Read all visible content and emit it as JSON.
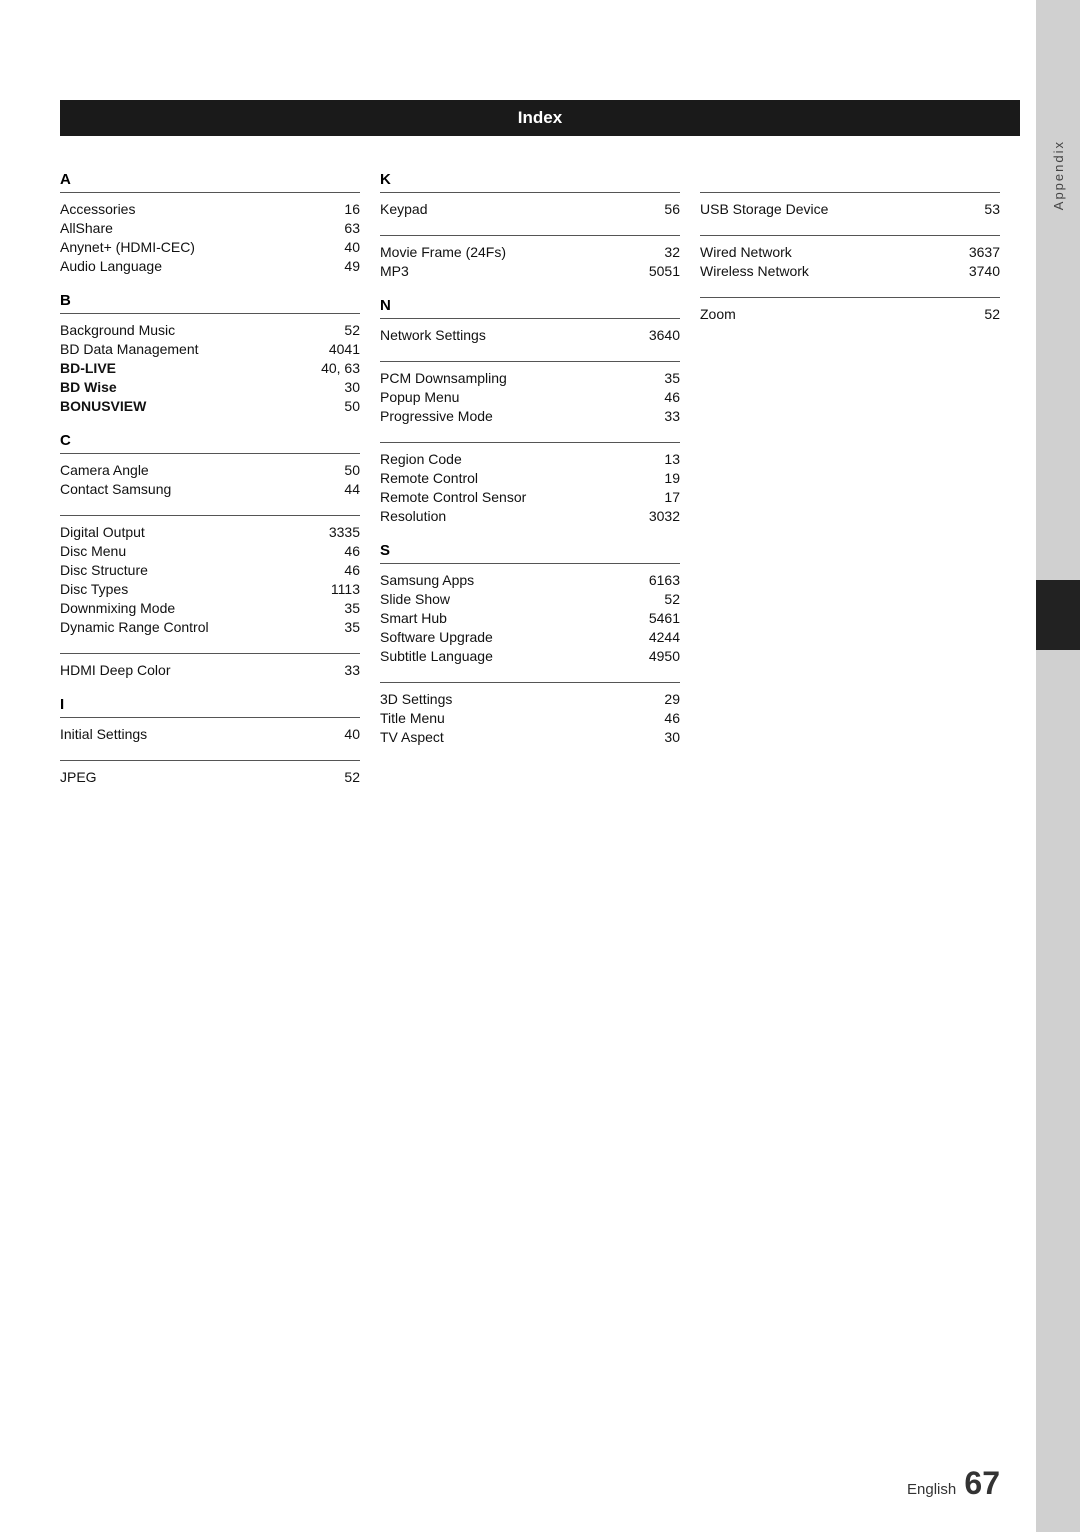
{
  "header": {
    "title": "Index"
  },
  "sidebar": {
    "label": "Appendix"
  },
  "footer": {
    "language": "English",
    "page_number": "67"
  },
  "sections": {
    "A": {
      "letter": "A",
      "entries": [
        {
          "name": "Accessories",
          "page": "16",
          "bold": false
        },
        {
          "name": "AllShare",
          "page": "63",
          "bold": false
        },
        {
          "name": "Anynet+ (HDMI-CEC)",
          "page": "40",
          "bold": false
        },
        {
          "name": "Audio Language",
          "page": "49",
          "bold": false
        }
      ]
    },
    "B": {
      "letter": "B",
      "entries": [
        {
          "name": "Background Music",
          "page": "52",
          "bold": false
        },
        {
          "name": "BD Data Management",
          "page": "4041",
          "bold": false
        },
        {
          "name": "BD-LIVE",
          "page": "40, 63",
          "bold": true
        },
        {
          "name": "BD Wise",
          "page": "30",
          "bold": true
        },
        {
          "name": "BONUSVIEW",
          "page": "50",
          "bold": true
        }
      ]
    },
    "C": {
      "letter": "C",
      "entries": [
        {
          "name": "Camera Angle",
          "page": "50",
          "bold": false
        },
        {
          "name": "Contact Samsung",
          "page": "44",
          "bold": false
        }
      ]
    },
    "D": {
      "letter": "",
      "entries": [
        {
          "name": "Digital Output",
          "page": "3335",
          "bold": false
        },
        {
          "name": "Disc Menu",
          "page": "46",
          "bold": false
        },
        {
          "name": "Disc Structure",
          "page": "46",
          "bold": false
        },
        {
          "name": "Disc Types",
          "page": "1113",
          "bold": false
        },
        {
          "name": "Downmixing Mode",
          "page": "35",
          "bold": false
        },
        {
          "name": "Dynamic Range Control",
          "page": "35",
          "bold": false
        }
      ]
    },
    "H": {
      "letter": "",
      "entries": [
        {
          "name": "HDMI Deep Color",
          "page": "33",
          "bold": false
        }
      ]
    },
    "I": {
      "letter": "I",
      "entries": [
        {
          "name": "Initial Settings",
          "page": "40",
          "bold": false
        }
      ]
    },
    "J": {
      "letter": "",
      "entries": [
        {
          "name": "JPEG",
          "page": "52",
          "bold": false
        }
      ]
    },
    "K": {
      "letter": "K",
      "entries": [
        {
          "name": "Keypad",
          "page": "56",
          "bold": false
        }
      ]
    },
    "M": {
      "letter": "",
      "entries": [
        {
          "name": "Movie Frame (24Fs)",
          "page": "32",
          "bold": false
        },
        {
          "name": "MP3",
          "page": "5051",
          "bold": false
        }
      ]
    },
    "N": {
      "letter": "N",
      "entries": [
        {
          "name": "Network Settings",
          "page": "3640",
          "bold": false
        }
      ]
    },
    "P": {
      "letter": "",
      "entries": [
        {
          "name": "PCM Downsampling",
          "page": "35",
          "bold": false
        },
        {
          "name": "Popup Menu",
          "page": "46",
          "bold": false
        },
        {
          "name": "Progressive Mode",
          "page": "33",
          "bold": false
        }
      ]
    },
    "R": {
      "letter": "",
      "entries": [
        {
          "name": "Region Code",
          "page": "13",
          "bold": false
        },
        {
          "name": "Remote Control",
          "page": "19",
          "bold": false
        },
        {
          "name": "Remote Control Sensor",
          "page": "17",
          "bold": false
        },
        {
          "name": "Resolution",
          "page": "3032",
          "bold": false
        }
      ]
    },
    "S": {
      "letter": "S",
      "entries": [
        {
          "name": "Samsung Apps",
          "page": "6163",
          "bold": false
        },
        {
          "name": "Slide Show",
          "page": "52",
          "bold": false
        },
        {
          "name": "Smart Hub",
          "page": "5461",
          "bold": false
        },
        {
          "name": "Software Upgrade",
          "page": "4244",
          "bold": false
        },
        {
          "name": "Subtitle Language",
          "page": "4950",
          "bold": false
        }
      ]
    },
    "T3": {
      "letter": "",
      "entries": [
        {
          "name": "3D Settings",
          "page": "29",
          "bold": false
        },
        {
          "name": "Title Menu",
          "page": "46",
          "bold": false
        },
        {
          "name": "TV Aspect",
          "page": "30",
          "bold": false
        }
      ]
    },
    "U": {
      "letter": "",
      "entries": [
        {
          "name": "USB Storage Device",
          "page": "53",
          "bold": false
        }
      ]
    },
    "W": {
      "letter": "",
      "entries": [
        {
          "name": "Wired Network",
          "page": "3637",
          "bold": false
        },
        {
          "name": "Wireless Network",
          "page": "3740",
          "bold": false
        }
      ]
    },
    "Z": {
      "letter": "",
      "entries": [
        {
          "name": "Zoom",
          "page": "52",
          "bold": false
        }
      ]
    }
  }
}
